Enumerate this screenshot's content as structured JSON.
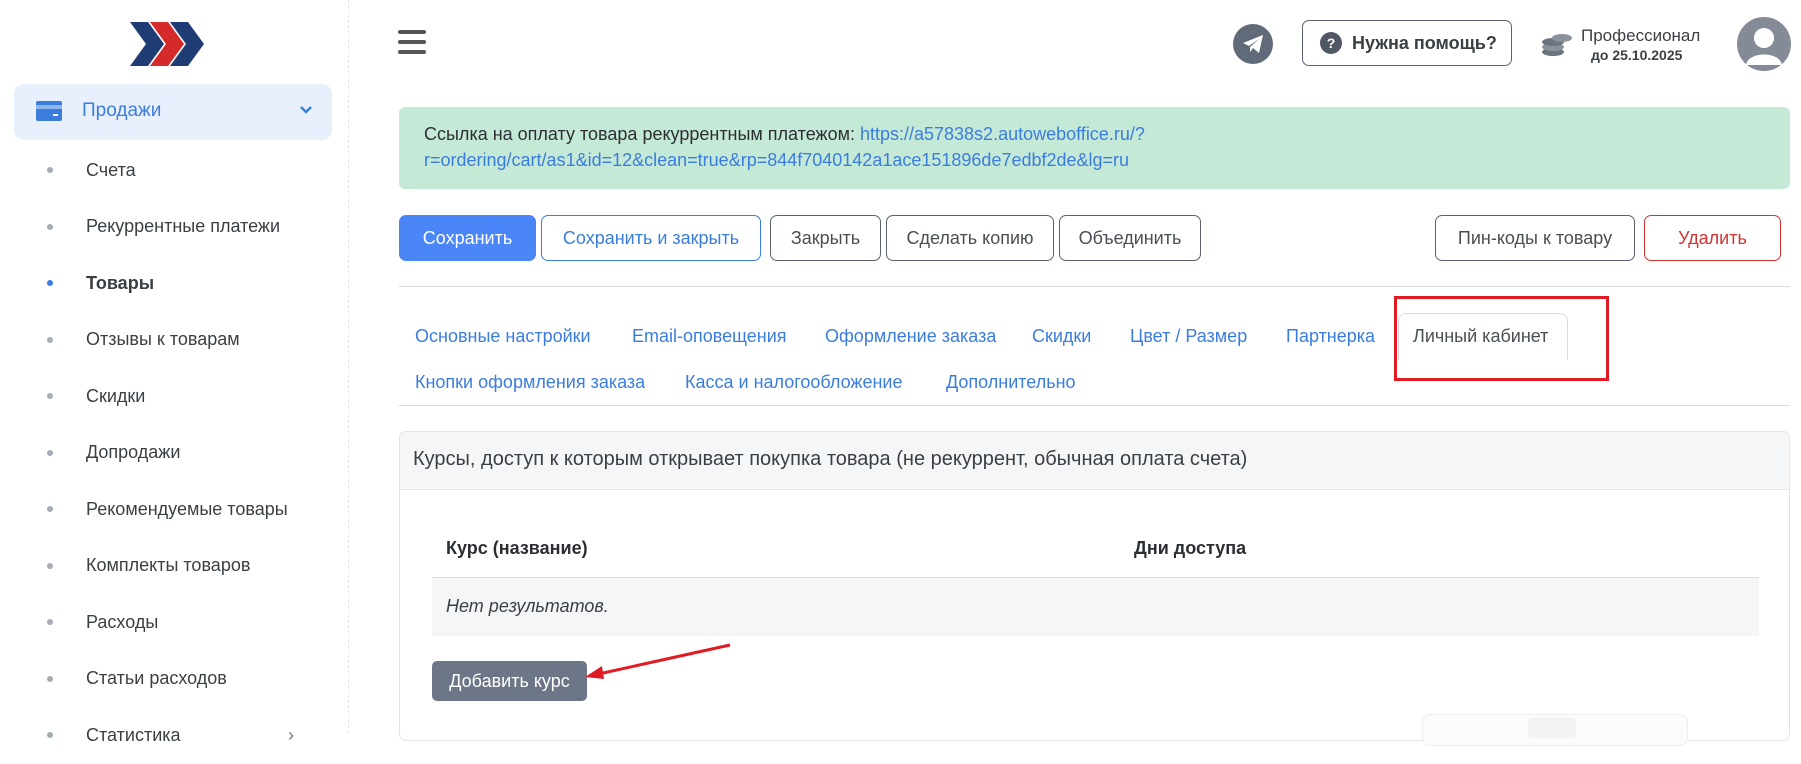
{
  "sidebar": {
    "active_section": "Продажи",
    "items": [
      {
        "label": "Счета",
        "active": false
      },
      {
        "label": "Рекуррентные платежи",
        "active": false
      },
      {
        "label": "Товары",
        "active": true
      },
      {
        "label": "Отзывы к товарам",
        "active": false
      },
      {
        "label": "Скидки",
        "active": false
      },
      {
        "label": "Допродажи",
        "active": false
      },
      {
        "label": "Рекомендуемые товары",
        "active": false
      },
      {
        "label": "Комплекты товаров",
        "active": false
      },
      {
        "label": "Расходы",
        "active": false
      },
      {
        "label": "Статьи расходов",
        "active": false
      },
      {
        "label": "Статистика",
        "active": false
      }
    ]
  },
  "topbar": {
    "help_label": "Нужна помощь?",
    "plan_name": "Профессионал",
    "plan_until": "до 25.10.2025"
  },
  "alert": {
    "text": "Ссылка на оплату товара рекуррентным платежом: ",
    "link_line1": "https://a57838s2.autoweboffice.ru/?",
    "link_line2": "r=ordering/cart/as1&id=12&clean=true&rp=844f7040142a1ace151896de7edbf2de&lg=ru"
  },
  "toolbar": {
    "save": "Сохранить",
    "save_close": "Сохранить и закрыть",
    "close": "Закрыть",
    "copy": "Сделать копию",
    "merge": "Объединить",
    "pin_codes": "Пин-коды к товару",
    "delete": "Удалить"
  },
  "tabs": {
    "main": "Основные настройки",
    "email": "Email-оповещения",
    "order_design": "Оформление заказа",
    "discounts": "Скидки",
    "color_size": "Цвет / Размер",
    "partner": "Партнерка",
    "cabinet": "Личный кабинет",
    "order_buttons": "Кнопки оформления заказа",
    "cashbox": "Касса и налогообложение",
    "extra": "Дополнительно",
    "active": "Личный кабинет"
  },
  "card": {
    "title": "Курсы, доступ к которым открывает покупка товара (не рекуррент, обычная оплата счета)",
    "col_course": "Курс (название)",
    "col_days": "Дни доступа",
    "empty": "Нет результатов.",
    "add_button": "Добавить курс"
  },
  "colors": {
    "primary": "#4a86f7",
    "link": "#3b7ddd",
    "danger": "#d23232",
    "alert_bg": "#c5e9d7",
    "highlight": "#e01b24"
  }
}
